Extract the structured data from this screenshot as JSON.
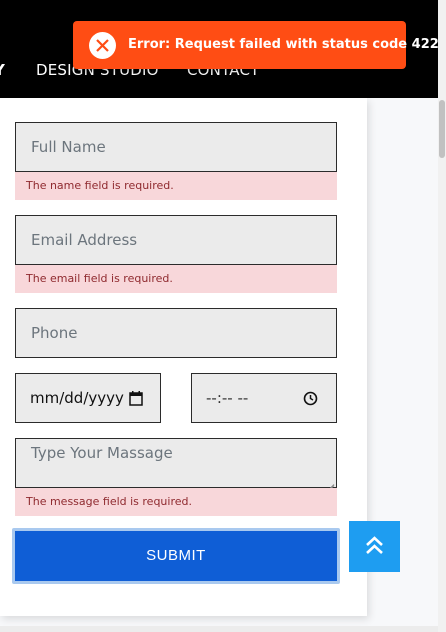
{
  "nav": {
    "partial": "Y",
    "items": [
      "DESIGN STUDIO",
      "CONTACT"
    ]
  },
  "form": {
    "name_placeholder": "Full Name",
    "name_error": "The name field is required.",
    "email_placeholder": "Email Address",
    "email_error": "The email field is required.",
    "phone_placeholder": "Phone",
    "date_value": "mm/dd/yyyy",
    "time_value": "--:-- --",
    "message_placeholder": "Type Your Massage",
    "message_error": "The message field is required.",
    "submit_label": "SUBMIT"
  },
  "toast": {
    "message": "Error: Request failed with status code 422",
    "color": "#ff4d14"
  },
  "colors": {
    "submit": "#0f5ed6",
    "scroll_top": "#1e9df1",
    "error_bg": "#f8d7da"
  },
  "icons": {
    "toast": "close-icon",
    "date": "calendar-icon",
    "time": "clock-icon",
    "scroll_top": "double-chevron-up-icon"
  }
}
